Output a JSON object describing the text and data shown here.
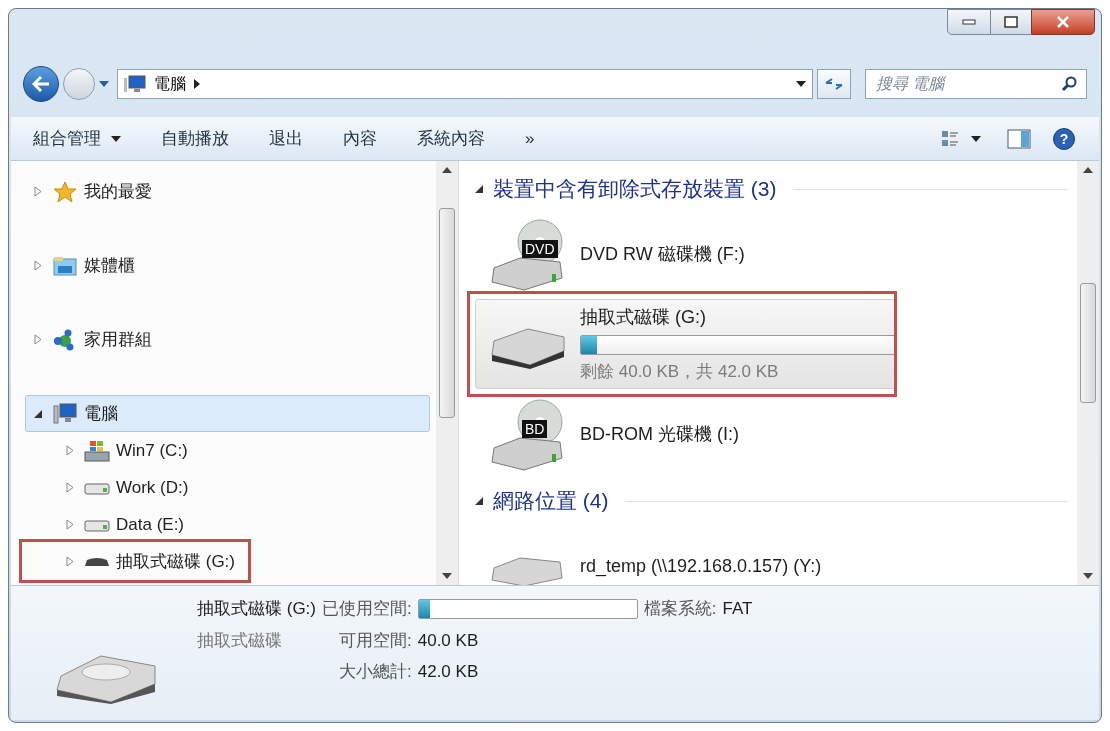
{
  "address_bar": {
    "segments": [
      "電腦"
    ]
  },
  "search": {
    "placeholder": "搜尋 電腦"
  },
  "toolbar": {
    "items": [
      {
        "label": "組合管理",
        "dropdown": true
      },
      {
        "label": "自動播放",
        "dropdown": false
      },
      {
        "label": "退出",
        "dropdown": false
      },
      {
        "label": "內容",
        "dropdown": false
      },
      {
        "label": "系統內容",
        "dropdown": false
      },
      {
        "label": "»",
        "dropdown": false
      }
    ]
  },
  "help_button": {
    "label": "?"
  },
  "nav_tree": [
    {
      "label": "我的最愛",
      "kind": "favorites",
      "expanded": false,
      "selected": false,
      "highlighted": false
    },
    {
      "label": "媒體櫃",
      "kind": "libraries",
      "expanded": false,
      "selected": false,
      "highlighted": false
    },
    {
      "label": "家用群組",
      "kind": "homegroup",
      "expanded": false,
      "selected": false,
      "highlighted": false
    },
    {
      "label": "電腦",
      "kind": "computer",
      "expanded": true,
      "selected": true,
      "highlighted": false,
      "children": [
        {
          "label": "Win7 (C:)",
          "kind": "system",
          "expanded": false,
          "selected": false,
          "highlighted": false
        },
        {
          "label": "Work (D:)",
          "kind": "disk",
          "expanded": false,
          "selected": false,
          "highlighted": false
        },
        {
          "label": "Data (E:)",
          "kind": "disk",
          "expanded": false,
          "selected": false,
          "highlighted": false
        },
        {
          "label": "抽取式磁碟 (G:)",
          "kind": "removable",
          "expanded": false,
          "selected": false,
          "highlighted": true
        }
      ]
    }
  ],
  "groups": [
    {
      "title": "裝置中含有卸除式存放裝置 (3)",
      "expanded": true,
      "items": [
        {
          "kind": "optical",
          "badge": "DVD",
          "name": "DVD RW 磁碟機 (F:)",
          "selected": false,
          "highlighted": false
        },
        {
          "kind": "removable",
          "name": "抽取式磁碟 (G:)",
          "level": 0.05,
          "detail": "剩餘 40.0 KB，共 42.0 KB",
          "selected": true,
          "highlighted": true
        },
        {
          "kind": "optical",
          "badge": "BD",
          "name": "BD-ROM 光碟機 (I:)",
          "selected": false,
          "highlighted": false
        }
      ]
    },
    {
      "title": "網路位置 (4)",
      "expanded": true,
      "items": [
        {
          "kind": "network",
          "name": "rd_temp (\\\\192.168.0.157) (Y:)",
          "selected": false,
          "highlighted": false
        }
      ]
    }
  ],
  "details": {
    "name": "抽取式磁碟 (G:)",
    "type": "抽取式磁碟",
    "used_label": "已使用空間:",
    "level": 0.05,
    "free_label": "可用空間:",
    "free_value": "40.0 KB",
    "total_label": "大小總計:",
    "total_value": "42.0 KB",
    "fs_label": "檔案系統:",
    "fs_value": "FAT"
  }
}
